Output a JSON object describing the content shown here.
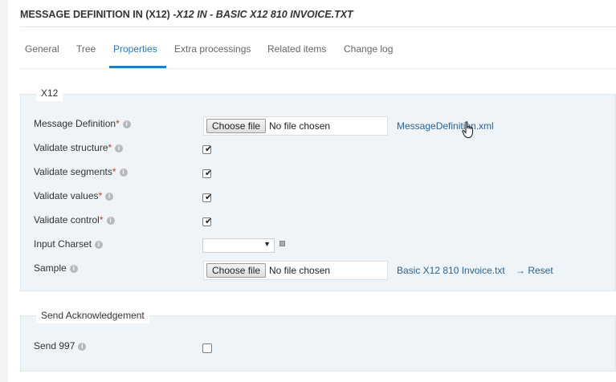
{
  "header": {
    "title_prefix": "MESSAGE DEFINITION IN (X12) ",
    "title_italic": "-X12 IN - BASIC X12 810 INVOICE.TXT"
  },
  "tabs": [
    {
      "label": "General",
      "active": false
    },
    {
      "label": "Tree",
      "active": false
    },
    {
      "label": "Properties",
      "active": true
    },
    {
      "label": "Extra processings",
      "active": false
    },
    {
      "label": "Related items",
      "active": false
    },
    {
      "label": "Change log",
      "active": false
    }
  ],
  "x12": {
    "legend": "X12",
    "message_definition": {
      "label": "Message Definition",
      "required": "*",
      "button": "Choose file",
      "file_text": "No file chosen",
      "link": "MessageDefinition.xml"
    },
    "validate_structure": {
      "label": "Validate structure",
      "required": "*",
      "checked": true
    },
    "validate_segments": {
      "label": "Validate segments",
      "required": "*",
      "checked": true
    },
    "validate_values": {
      "label": "Validate values",
      "required": "*",
      "checked": true
    },
    "validate_control": {
      "label": "Validate control",
      "required": "*",
      "checked": true
    },
    "input_charset": {
      "label": "Input Charset",
      "value": ""
    },
    "sample": {
      "label": "Sample",
      "button": "Choose file",
      "file_text": "No file chosen",
      "link": "Basic X12 810 Invoice.txt",
      "reset": "→ Reset"
    }
  },
  "ack": {
    "legend": "Send Acknowledgement",
    "send_997": {
      "label": "Send 997",
      "checked": false
    }
  },
  "icons": {
    "info": "i",
    "check": "✔",
    "dropdown": "▼"
  },
  "colors": {
    "accent": "#2a7ab8",
    "link": "#2a6496",
    "required": "#c0392b",
    "panel": "#eef4f7"
  }
}
